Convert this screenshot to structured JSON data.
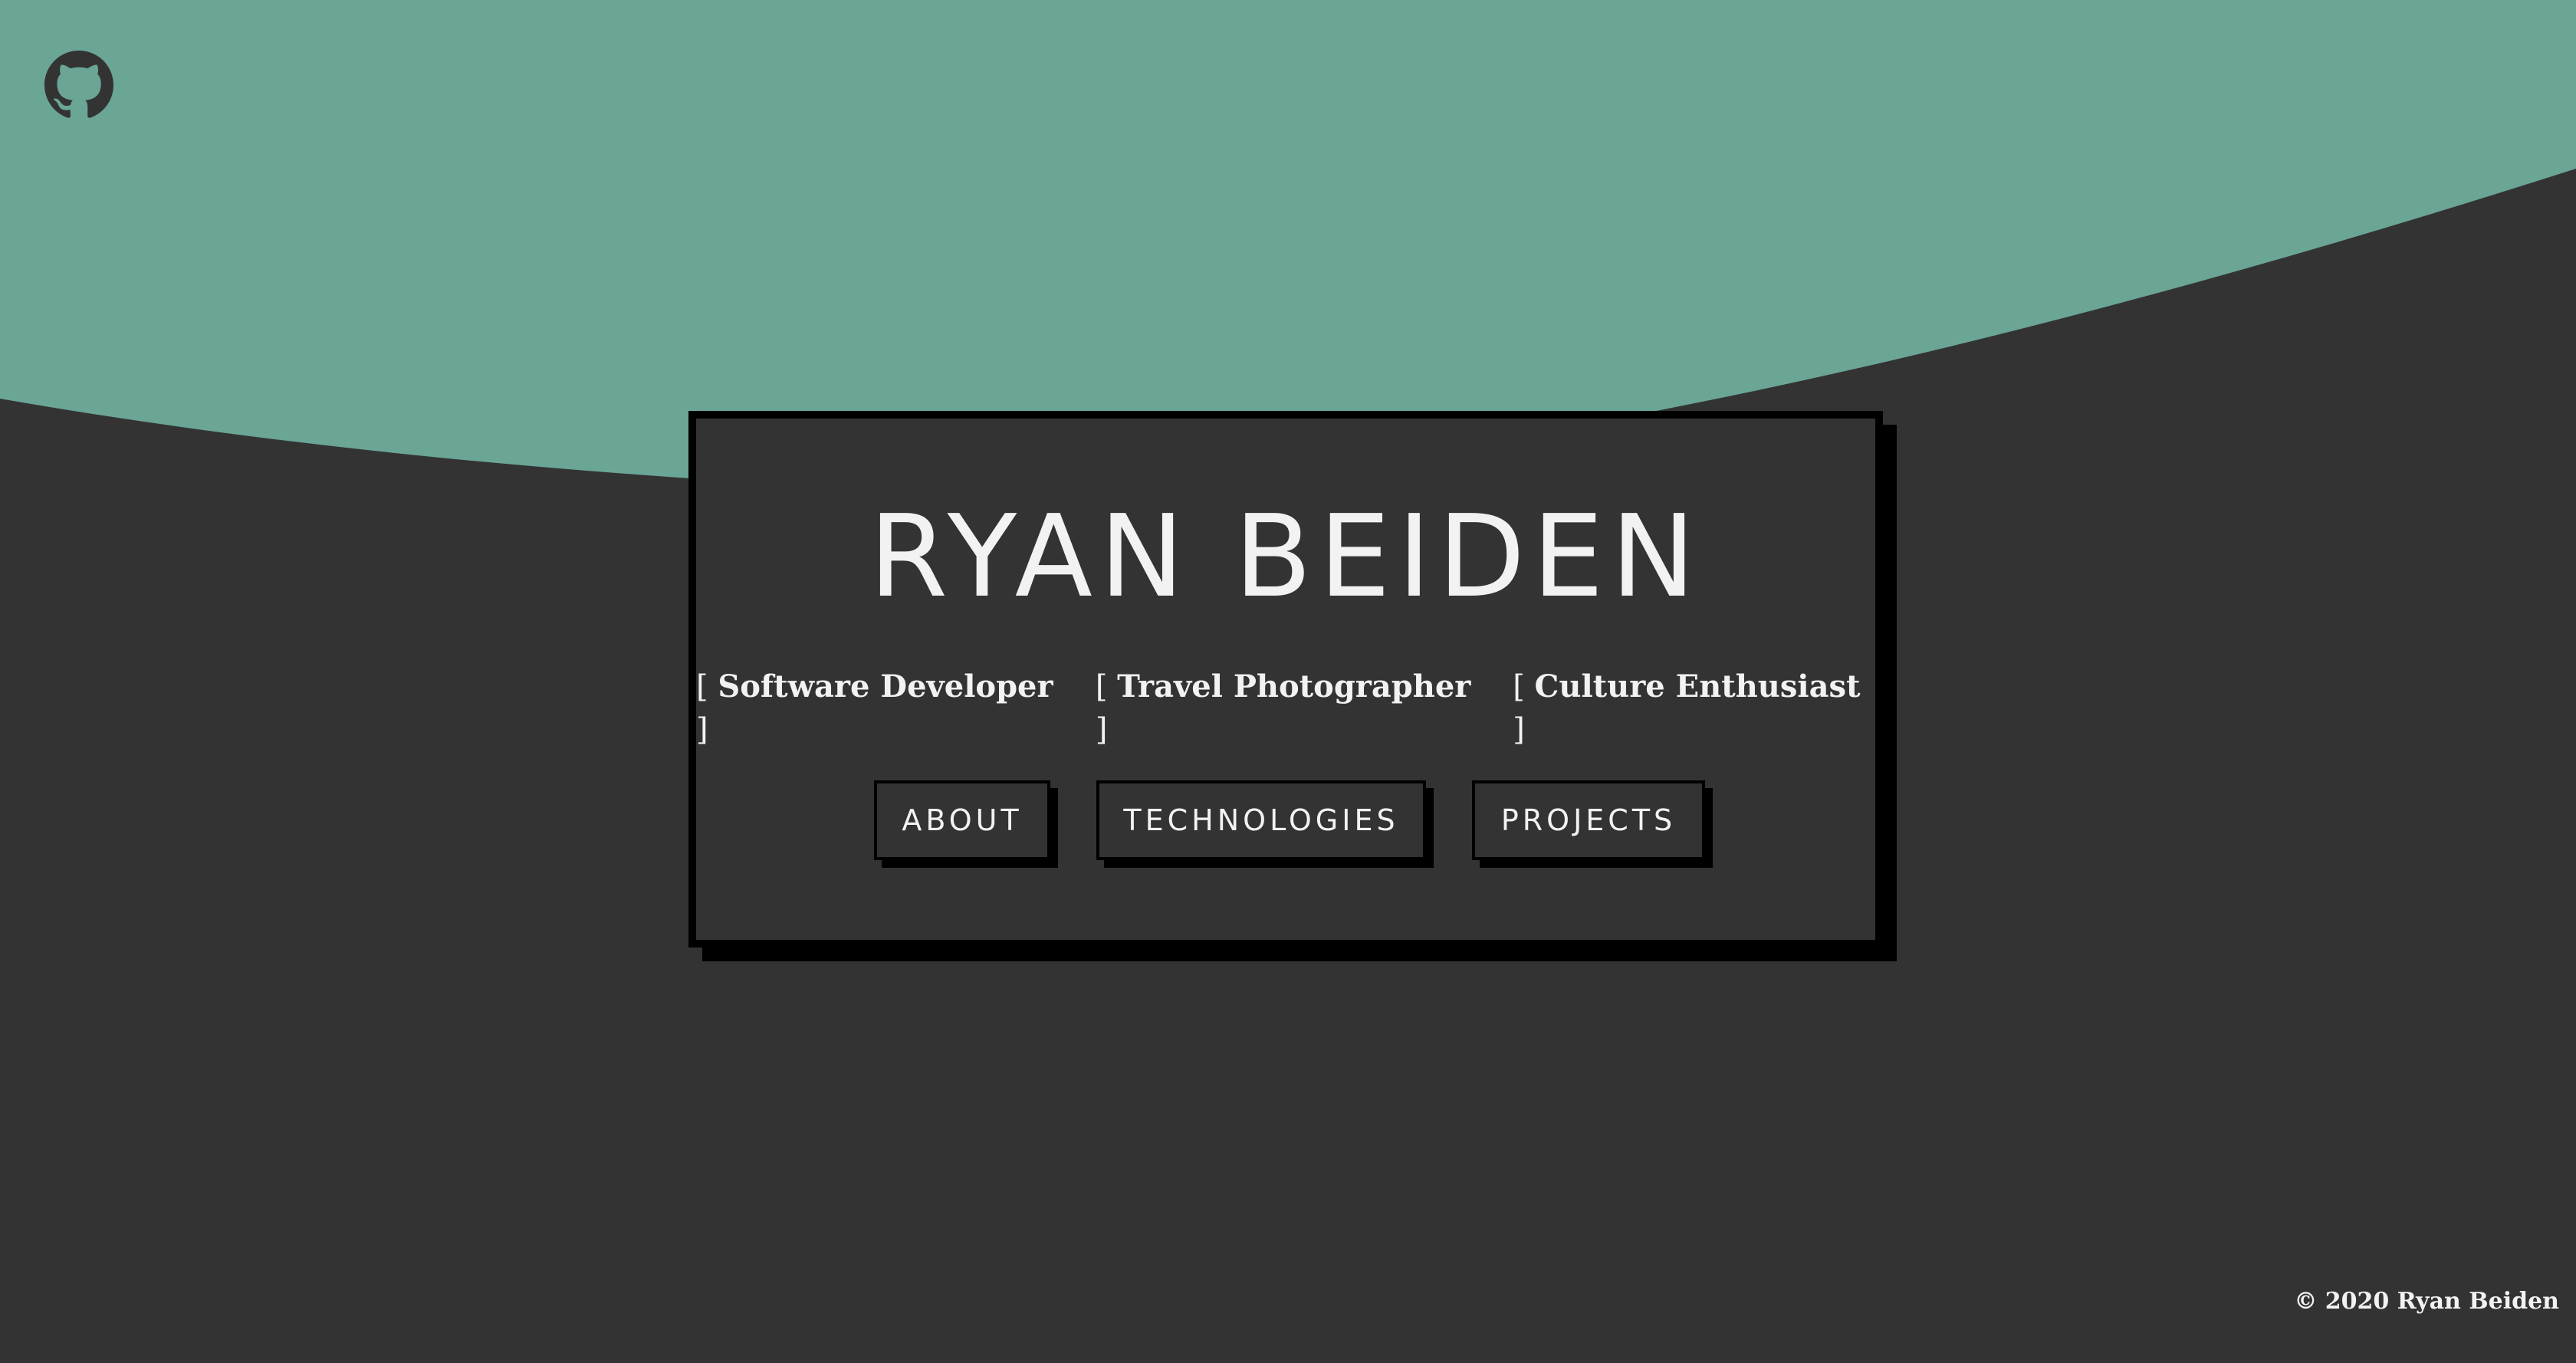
{
  "colors": {
    "background": "#333333",
    "accent_wave": "#6aa596",
    "text": "#f2f2f2",
    "border": "#000000"
  },
  "header": {
    "github_icon": "github-icon"
  },
  "hero": {
    "name": "RYAN BEIDEN",
    "taglines": [
      {
        "open": "[",
        "text": "Software Developer",
        "close": "]"
      },
      {
        "open": "[",
        "text": "Travel Photographer",
        "close": "]"
      },
      {
        "open": "[",
        "text": "Culture Enthusiast",
        "close": "]"
      }
    ]
  },
  "nav": {
    "items": [
      {
        "label": "ABOUT"
      },
      {
        "label": "TECHNOLOGIES"
      },
      {
        "label": "PROJECTS"
      }
    ]
  },
  "footer": {
    "copyright": "© 2020 Ryan Beiden"
  }
}
